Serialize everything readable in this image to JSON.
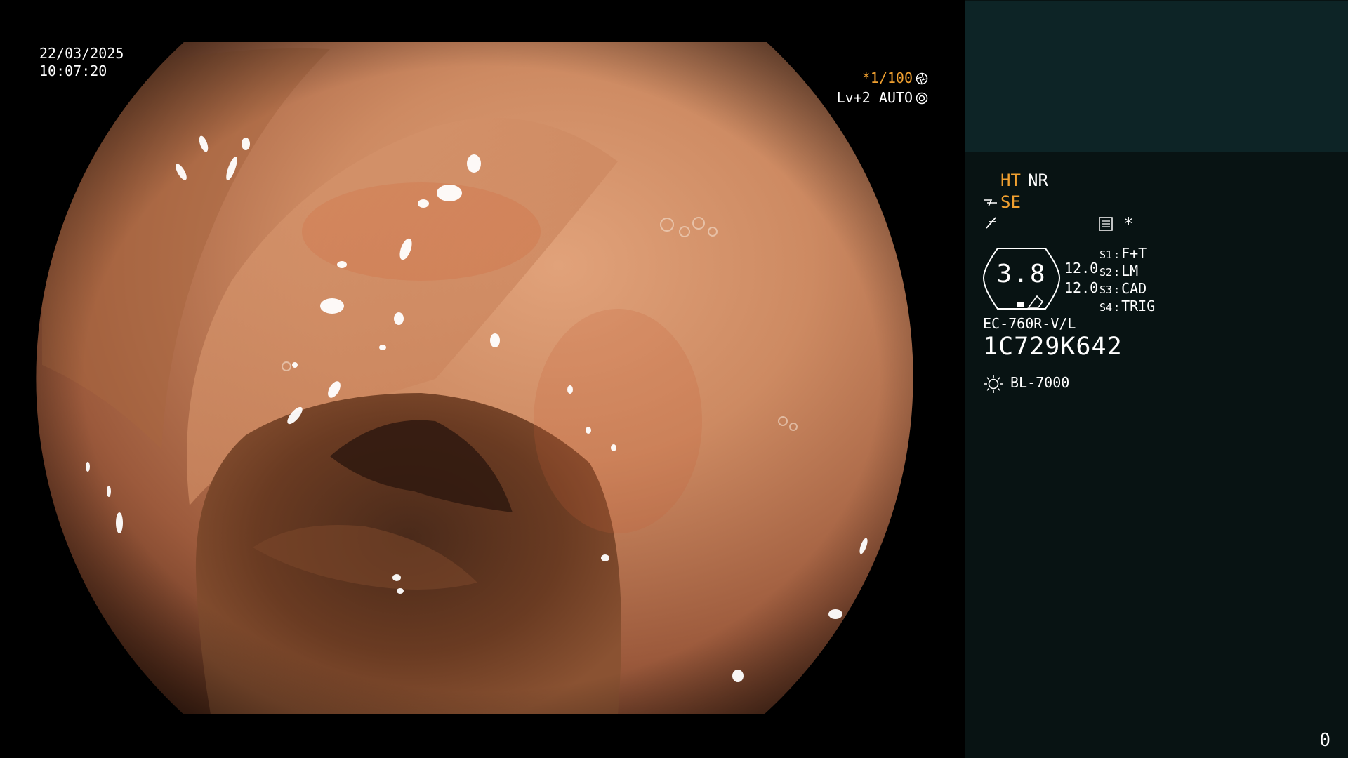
{
  "overlay": {
    "date": "22/03/2025",
    "time": "10:07:20",
    "shutter": "*1/100",
    "level": "Lv+2 AUTO"
  },
  "panel": {
    "mode_ht": "HT",
    "mode_nr": "NR",
    "mode_se": "SE",
    "star": "*",
    "gauge_value": "3.8",
    "gauge_r1": "12.0",
    "gauge_r2": "12.0",
    "switches": [
      {
        "key": "S1",
        "value": "F+T"
      },
      {
        "key": "S2",
        "value": "LM"
      },
      {
        "key": "S3",
        "value": "CAD"
      },
      {
        "key": "S4",
        "value": "TRIG"
      }
    ],
    "scope_model": "EC-760R-V/L",
    "scope_serial": "1C729K642",
    "light_source": "BL-7000",
    "frame_count": "0"
  },
  "colors": {
    "accent_orange": "#f0a030",
    "panel_bg": "#081313",
    "thumb_bg": "#0d2426",
    "mucosa": "#c9845c"
  },
  "icons": [
    "shutter-icon",
    "auto-iris-icon",
    "se-icon",
    "slash-icon",
    "memo-icon",
    "light-icon"
  ]
}
